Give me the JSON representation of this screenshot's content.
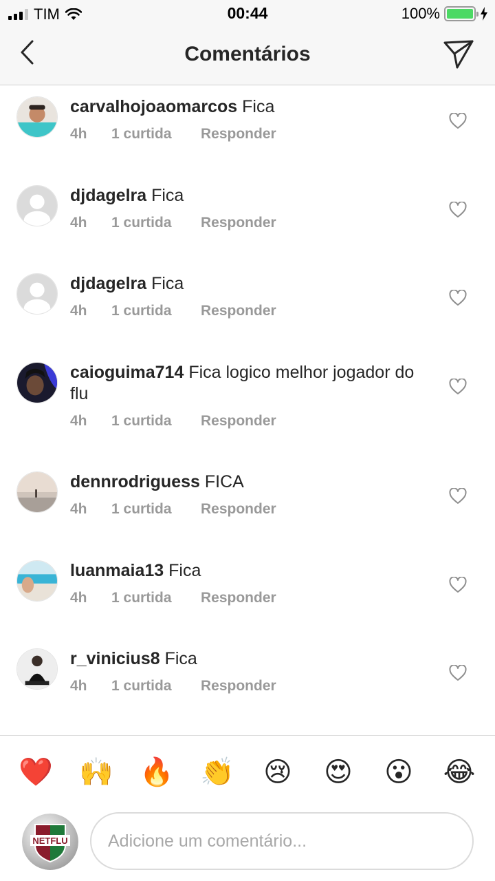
{
  "status_bar": {
    "carrier": "TIM",
    "time": "00:44",
    "battery": "100%",
    "battery_level": 1.0
  },
  "header": {
    "title": "Comentários",
    "back_icon": "chevron-left-icon",
    "send_icon": "paper-plane-icon"
  },
  "comments": [
    {
      "username": "carvalhojoaomarcos",
      "text": "Fica",
      "time": "4h",
      "likes": "1 curtida",
      "reply": "Responder"
    },
    {
      "username": "djdagelra",
      "text": "Fica",
      "time": "4h",
      "likes": "1 curtida",
      "reply": "Responder"
    },
    {
      "username": "djdagelra",
      "text": "Fica",
      "time": "4h",
      "likes": "1 curtida",
      "reply": "Responder"
    },
    {
      "username": "caioguima714",
      "text": "Fica logico melhor jogador do flu",
      "time": "4h",
      "likes": "1 curtida",
      "reply": "Responder"
    },
    {
      "username": "dennrodriguess",
      "text": "FICA",
      "time": "4h",
      "likes": "1 curtida",
      "reply": "Responder"
    },
    {
      "username": "luanmaia13",
      "text": "Fica",
      "time": "4h",
      "likes": "1 curtida",
      "reply": "Responder"
    },
    {
      "username": "r_vinicius8",
      "text": "Fica",
      "time": "4h",
      "likes": "1 curtida",
      "reply": "Responder"
    }
  ],
  "emoji_bar": [
    "❤️",
    "🙌",
    "🔥",
    "👏",
    "😢",
    "😍",
    "😮",
    "😂"
  ],
  "composer": {
    "placeholder": "Adicione um comentário...",
    "avatar_text": "NETFLU"
  },
  "colors": {
    "accent_green": "#4cd964",
    "muted_text": "#999999",
    "text": "#262626",
    "header_bg": "#f7f7f7"
  }
}
